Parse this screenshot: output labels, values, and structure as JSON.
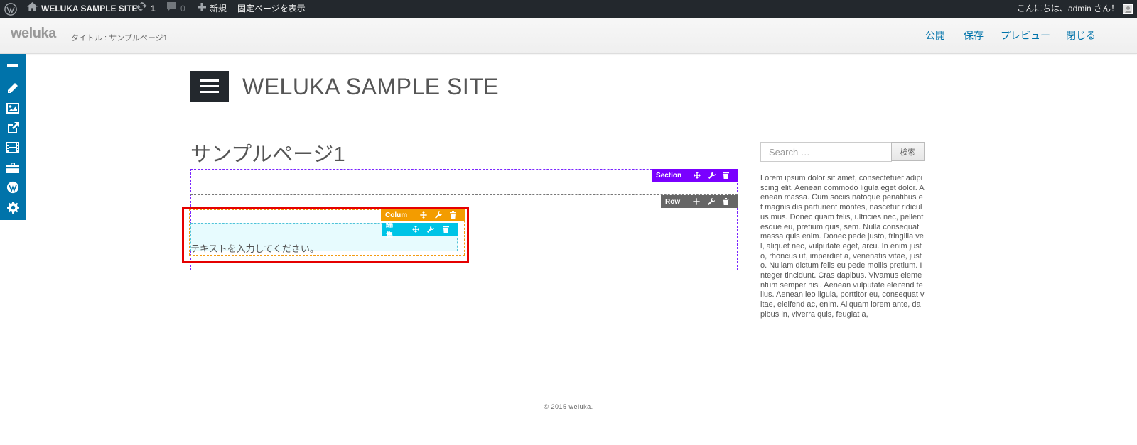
{
  "admin_bar": {
    "site_name": "WELUKA SAMPLE SITE",
    "updates_count": "1",
    "comments_count": "0",
    "new_label": "新規",
    "view_page_label": "固定ページを表示",
    "greeting": "こんにちは、admin さん！"
  },
  "editor_header": {
    "logo": "weluka",
    "title": "タイトル : サンプルページ1",
    "buttons": {
      "publish": "公開",
      "save": "保存",
      "preview": "プレビュー",
      "close": "閉じる"
    }
  },
  "tool_panel": {
    "icons": [
      "minus-icon",
      "pencil-icon",
      "image-icon",
      "external-link-icon",
      "film-icon",
      "briefcase-icon",
      "wordpress-icon",
      "gear-icon"
    ]
  },
  "site": {
    "title": "WELUKA SAMPLE SITE"
  },
  "page": {
    "title": "サンプルページ1"
  },
  "builder": {
    "section_label": "Section",
    "row_label": "Row",
    "column_label": "Colum",
    "edit_label": "編集",
    "text_placeholder": "テキストを入力してください。"
  },
  "sidebar": {
    "search_placeholder": "Search …",
    "search_button": "検索",
    "text": "Lorem ipsum dolor sit amet, consectetuer adipiscing elit. Aenean commodo ligula eget dolor. Aenean massa. Cum sociis natoque penatibus et magnis dis parturient montes, nascetur ridiculus mus. Donec quam felis, ultricies nec, pellentesque eu, pretium quis, sem. Nulla consequat massa quis enim. Donec pede justo, fringilla vel, aliquet nec, vulputate eget, arcu. In enim justo, rhoncus ut, imperdiet a, venenatis vitae, justo. Nullam dictum felis eu pede mollis pretium. Integer tincidunt. Cras dapibus. Vivamus elementum semper nisi. Aenean vulputate eleifend tellus. Aenean leo ligula, porttitor eu, consequat vitae, eleifend ac, enim. Aliquam lorem ante, dapibus in, viverra quis, feugiat a,"
  },
  "footer": {
    "copyright": "© 2015 weluka."
  },
  "colors": {
    "admin_bar": "#23282d",
    "accent": "#0073aa",
    "section": "#7a00ff",
    "row": "#666666",
    "column": "#f39c00",
    "edit": "#00c4e6",
    "selection": "#e50000"
  }
}
